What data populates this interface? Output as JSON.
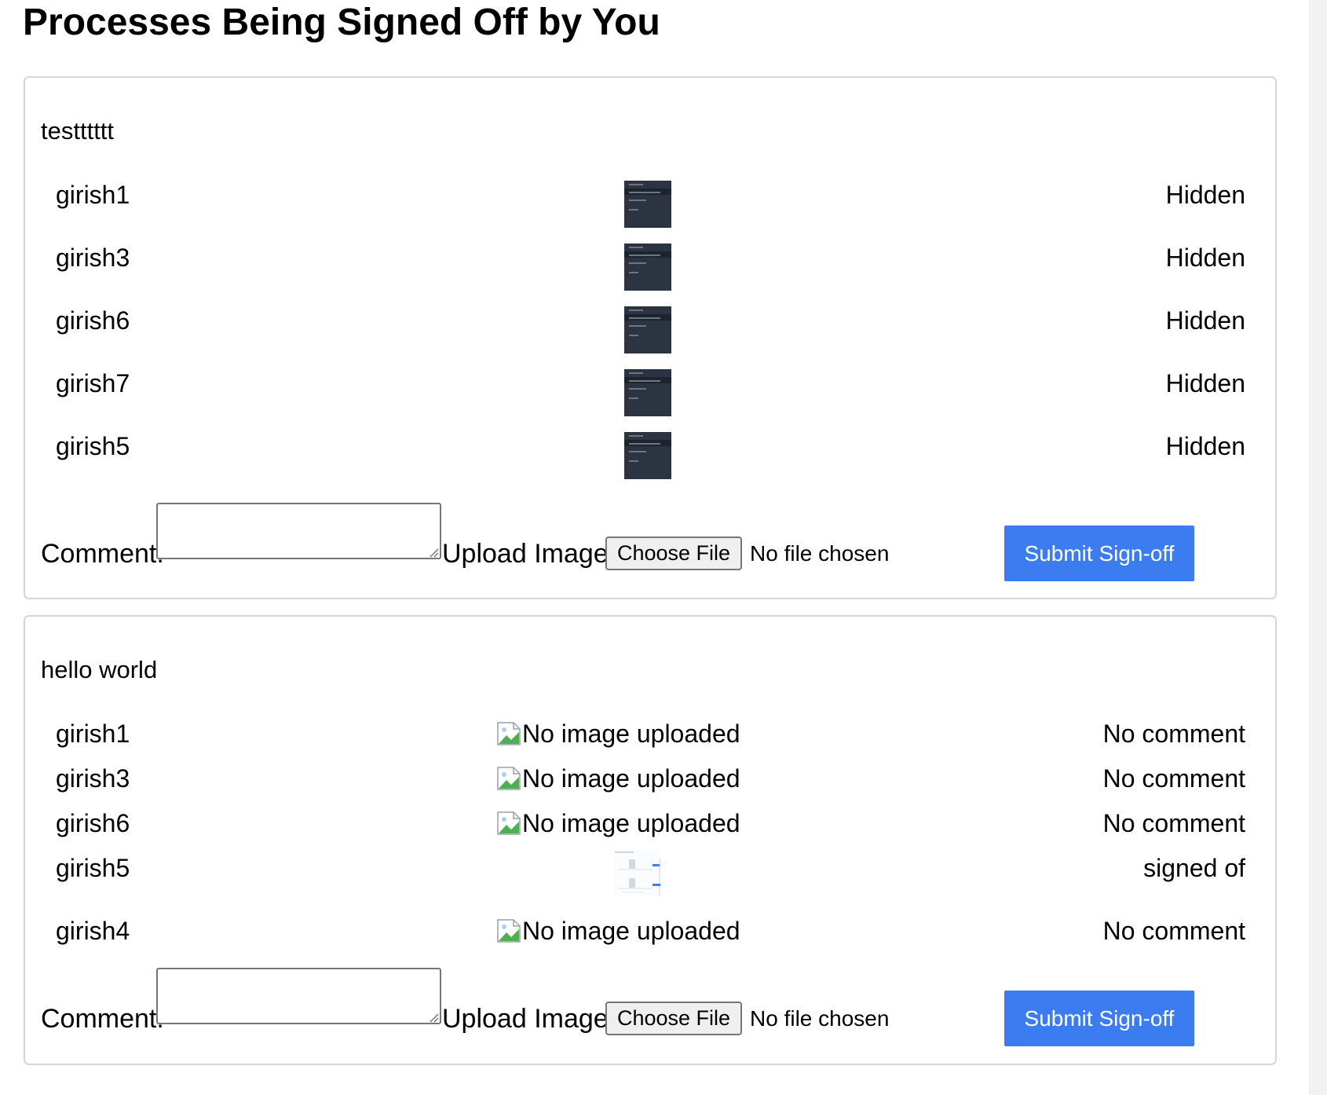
{
  "page": {
    "title": "Processes Being Signed Off by You"
  },
  "colors": {
    "accent": "#3b7cf0",
    "card_border": "#d6d6d6",
    "thumbnail_dark": "#2b3440"
  },
  "processes": [
    {
      "name": "testttttt",
      "signers": [
        {
          "name": "girish1",
          "image": "screenshot-thumbnail",
          "status": "Hidden"
        },
        {
          "name": "girish3",
          "image": "screenshot-thumbnail",
          "status": "Hidden"
        },
        {
          "name": "girish6",
          "image": "screenshot-thumbnail",
          "status": "Hidden"
        },
        {
          "name": "girish7",
          "image": "screenshot-thumbnail",
          "status": "Hidden"
        },
        {
          "name": "girish5",
          "image": "screenshot-thumbnail",
          "status": "Hidden"
        }
      ],
      "form": {
        "comment_label": "Comment:",
        "comment_value": "",
        "upload_label": "Upload Image:",
        "choose_file_label": "Choose File",
        "file_status": "No file chosen",
        "submit_label": "Submit Sign-off"
      }
    },
    {
      "name": "hello world",
      "signers": [
        {
          "name": "girish1",
          "image": "broken-image-icon",
          "image_alt": "No image uploaded",
          "status": "No comment"
        },
        {
          "name": "girish3",
          "image": "broken-image-icon",
          "image_alt": "No image uploaded",
          "status": "No comment"
        },
        {
          "name": "girish6",
          "image": "broken-image-icon",
          "image_alt": "No image uploaded",
          "status": "No comment"
        },
        {
          "name": "girish5",
          "image": "screenshot-thumbnail",
          "status": "signed of"
        },
        {
          "name": "girish4",
          "image": "broken-image-icon",
          "image_alt": "No image uploaded",
          "status": "No comment"
        }
      ],
      "form": {
        "comment_label": "Comment:",
        "comment_value": "",
        "upload_label": "Upload Image:",
        "choose_file_label": "Choose File",
        "file_status": "No file chosen",
        "submit_label": "Submit Sign-off"
      }
    }
  ]
}
